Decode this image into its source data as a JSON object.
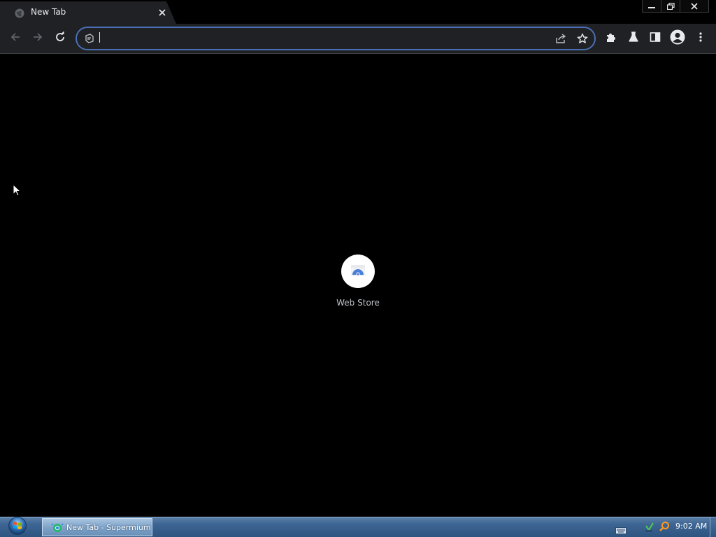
{
  "browser": {
    "tab": {
      "title": "New Tab",
      "favicon": "globe-icon",
      "close_icon": "close-icon"
    },
    "window_controls": [
      "minimize-icon",
      "restore-icon",
      "close-icon"
    ],
    "toolbar": {
      "back_icon": "arrow-left-icon",
      "forward_icon": "arrow-right-icon",
      "reload_icon": "reload-icon",
      "omnibox": {
        "value": "",
        "placeholder": "",
        "site_icon": "page-icon",
        "share_icon": "share-icon",
        "bookmark_icon": "star-icon"
      },
      "extensions_icon": "puzzle-icon",
      "labs_icon": "flask-icon",
      "side_panel_icon": "side-panel-icon",
      "profile_icon": "avatar-icon",
      "menu_icon": "kebab-menu-icon"
    },
    "accent_color": "#4a6fb5"
  },
  "new_tab_page": {
    "shortcuts": [
      {
        "label": "Web Store",
        "icon": "web-store-icon"
      }
    ]
  },
  "taskbar": {
    "start_icon": "windows-start-orb-icon",
    "tasks": [
      {
        "label": "New Tab - Supermium",
        "icon": "supermium-icon"
      }
    ],
    "tray_icons": [
      "keyboard-icon",
      "network-icon",
      "search-icon"
    ],
    "clock": "9:02 AM"
  }
}
